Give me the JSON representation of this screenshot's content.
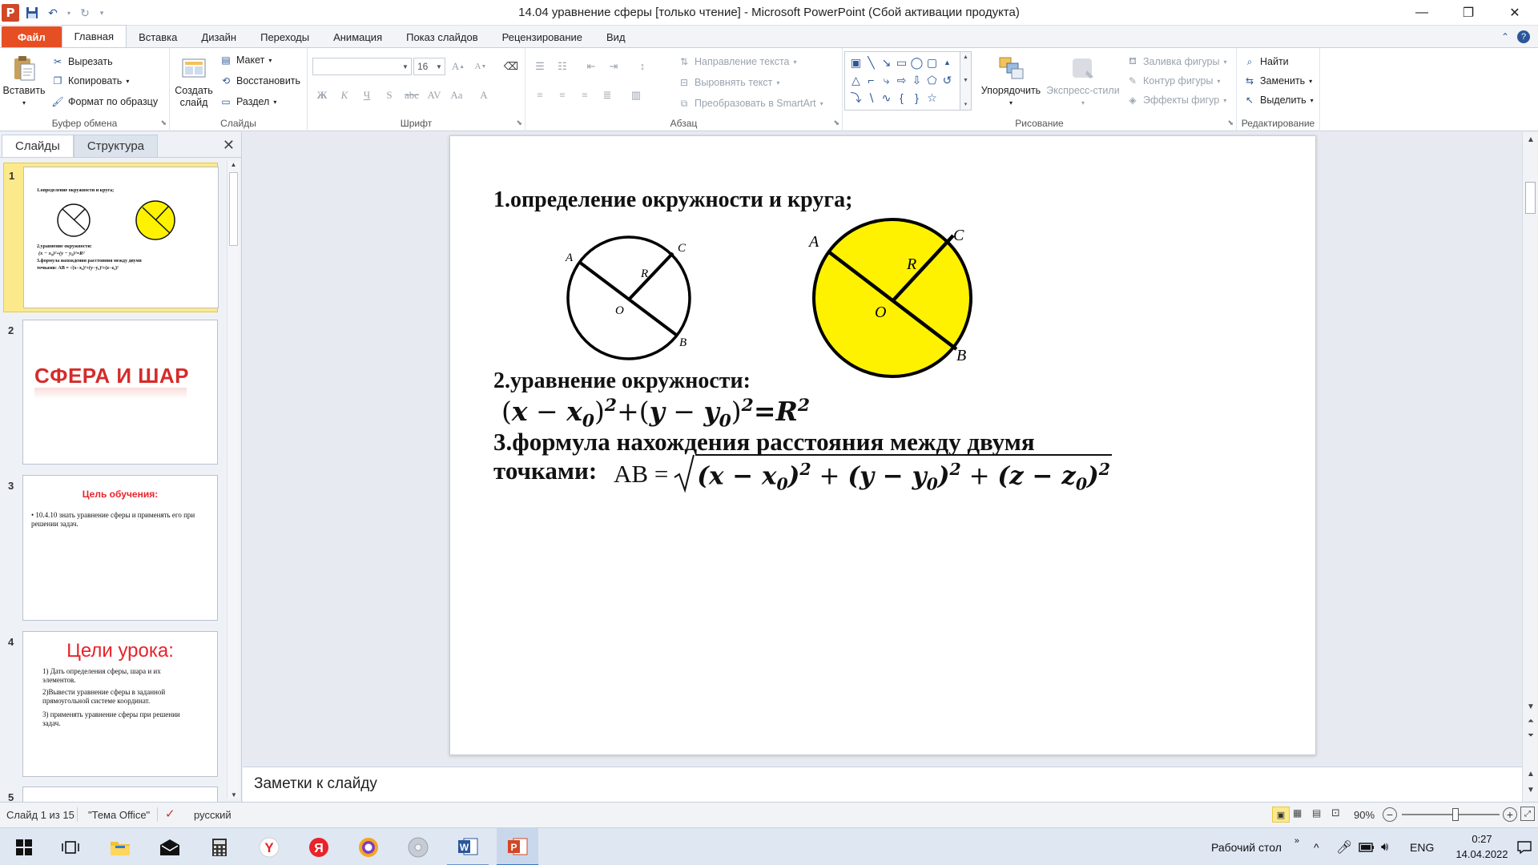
{
  "window": {
    "title": "14.04 уравнение сферы [только чтение]  -  Microsoft PowerPoint (Сбой активации продукта)",
    "app_icon": "P",
    "controls": {
      "minimize": "—",
      "restore": "❐",
      "close": "✕"
    }
  },
  "tabs": [
    "Файл",
    "Главная",
    "Вставка",
    "Дизайн",
    "Переходы",
    "Анимация",
    "Показ слайдов",
    "Рецензирование",
    "Вид"
  ],
  "active_tab": "Главная",
  "ribbon": {
    "clipboard": {
      "paste": "Вставить",
      "cut": "Вырезать",
      "copy": "Копировать",
      "format_painter": "Формат по образцу",
      "label": "Буфер обмена"
    },
    "slides": {
      "new_slide_line1": "Создать",
      "new_slide_line2": "слайд",
      "layout": "Макет",
      "reset": "Восстановить",
      "section": "Раздел",
      "label": "Слайды"
    },
    "font": {
      "font_name": "",
      "font_size": "16",
      "label": "Шрифт"
    },
    "paragraph": {
      "text_direction": "Направление текста",
      "align_text": "Выровнять текст",
      "smartart": "Преобразовать в SmartArt",
      "label": "Абзац"
    },
    "drawing": {
      "arrange": "Упорядочить",
      "quick_styles": "Экспресс-стили",
      "shape_fill": "Заливка фигуры",
      "shape_outline": "Контур фигуры",
      "shape_effects": "Эффекты фигур",
      "label": "Рисование"
    },
    "editing": {
      "find": "Найти",
      "replace": "Заменить",
      "select": "Выделить",
      "label": "Редактирование"
    }
  },
  "left_panel": {
    "tabs": [
      "Слайды",
      "Структура"
    ],
    "active_tab": "Слайды",
    "thumbnails": [
      {
        "num": "1",
        "line1": "1.определение окружности и круга;",
        "line2": "2.уравнение окружности:",
        "line3": "(x − x₀)²+(y − y₀)²=R²",
        "line4": "3.формула нахождения расстояния между двумя",
        "line5": "точками:  AB = √(x−x₀)²+(y−y₀)²+(z−z₀)²"
      },
      {
        "num": "2",
        "title": "СФЕРА И ШАР"
      },
      {
        "num": "3",
        "title": "Цель обучения:",
        "bullet": "10.4.10 знать уравнение сферы и применять его при решении задач."
      },
      {
        "num": "4",
        "title": "Цели урока:",
        "items": [
          "1) Дать определения сферы, шара и их элементов.",
          "2)Вывести уравнение сферы в заданной прямоугольной системе координат.",
          "3) применять уравнение сферы при решении задач."
        ]
      },
      {
        "num": "5"
      }
    ]
  },
  "slide": {
    "heading1": "1.определение окружности и круга;",
    "heading2": "2.уравнение окружности:",
    "heading3": "3.формула нахождения  расстояния  между  двумя",
    "heading3_cont": "точками:",
    "formula_circle": {
      "lead": "(",
      "x": "x",
      "minus1": " − ",
      "x0": "x",
      "sub0": "0",
      "close1": ")",
      "sq1": "2",
      "plus": "+(",
      "y": "y",
      "minus2": " − ",
      "y0": "y",
      "sub0b": "0",
      "close2": ")",
      "sq2": "2",
      "eq": "=",
      "R": "R",
      "sq3": "2"
    },
    "formula_distance": "AB = √((x − x₀)² + (y − y₀)² + (z − z₀)²)",
    "formula_distance_parts": {
      "ab": "AB =",
      "t1": "(x − x",
      "t1s": "0",
      "t1e": ")",
      "p1": "2",
      "plus1": " + ",
      "t2": "(y − y",
      "t2s": "0",
      "t2e": ")",
      "p2": "2",
      "plus2": " + ",
      "t3": "(z − z",
      "t3s": "0",
      "t3e": ")",
      "p3": "2"
    },
    "circle_white_labels": {
      "a": "A",
      "b": "B",
      "c": "C",
      "o": "O",
      "r": "R"
    },
    "circle_yellow_labels": {
      "a": "A",
      "b": "B",
      "c": "C",
      "o": "O",
      "r": "R"
    },
    "colors": {
      "yellow_fill": "#FFF200",
      "thumb_red": "#E8232A",
      "title_red": "#C0272D"
    }
  },
  "notes": {
    "placeholder": "Заметки к слайду"
  },
  "status": {
    "slide_info": "Слайд 1 из 15",
    "theme": "\"Тема Office\"",
    "language": "русский",
    "zoom": "90%",
    "zoom_fraction": 0.55
  },
  "taskbar": {
    "desktop_label": "Рабочий стол",
    "lang": "ENG",
    "time": "0:27",
    "date": "14.04.2022"
  }
}
